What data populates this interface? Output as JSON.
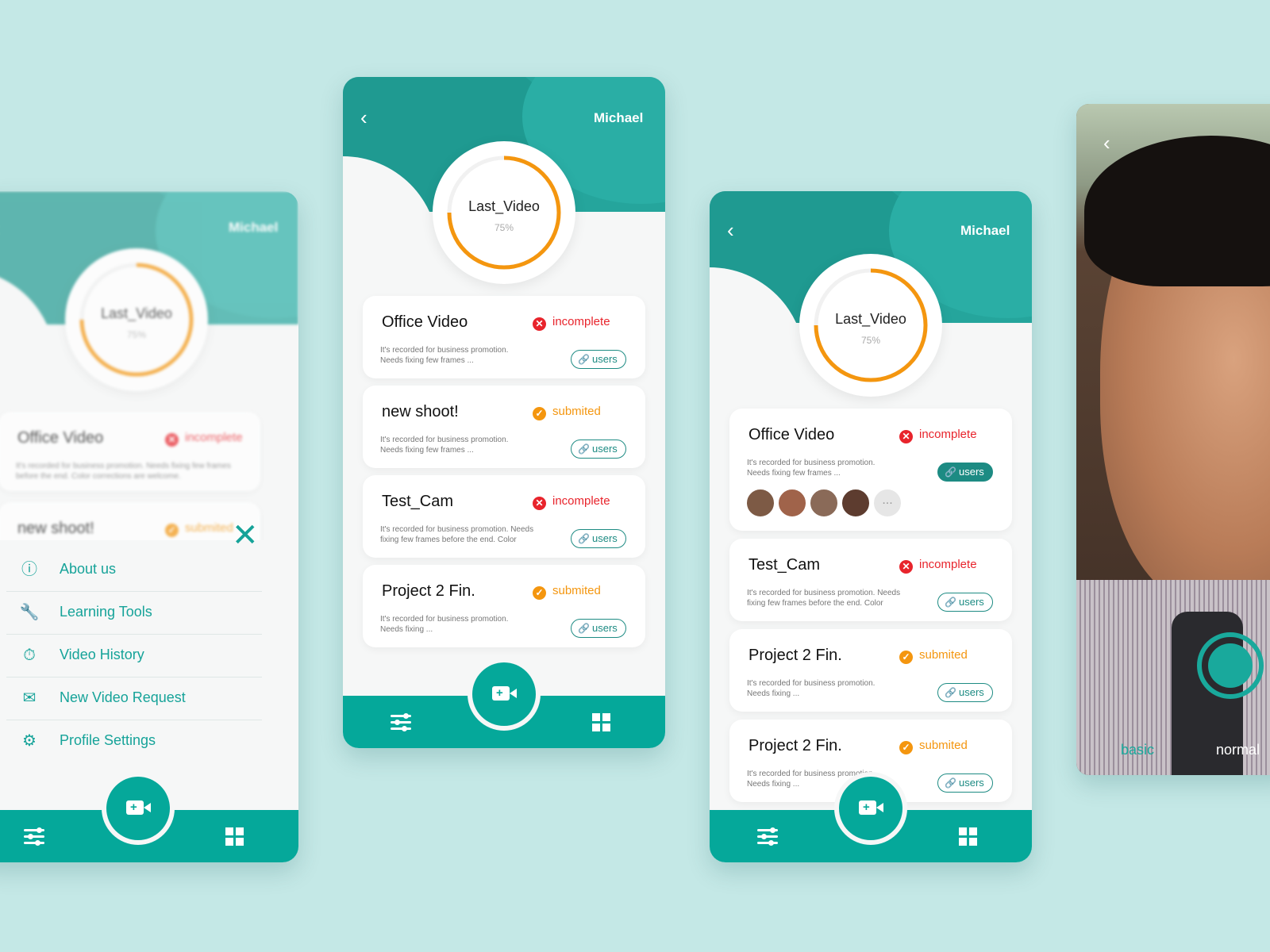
{
  "colors": {
    "teal": "#05a89a",
    "orange": "#f4960f",
    "red": "#e8242c",
    "background": "#c4e8e6"
  },
  "icons": {
    "back": "chevron-left-icon",
    "status_incomplete": "x-circle-icon",
    "status_submitted": "check-circle-icon",
    "users": "link-icon",
    "record": "video-camera-plus-icon",
    "filters": "sliders-icon",
    "apps": "grid-icon",
    "close": "close-icon"
  },
  "user_name": "Michael",
  "last_video": {
    "title": "Last_Video",
    "percent": "75%",
    "progress": 0.75
  },
  "users_label": "users",
  "screen1": {
    "cards": [
      {
        "title": "Office Video",
        "status": "incomplete",
        "desc": "It's recorded for business promotion. Needs fixing few frames before the end. Color corrections are welcome."
      },
      {
        "title": "new shoot!",
        "status": "submited"
      }
    ],
    "menu": [
      {
        "label": "About us",
        "icon": "info-icon"
      },
      {
        "label": "Learning Tools",
        "icon": "wrench-icon"
      },
      {
        "label": "Video History",
        "icon": "stopwatch-icon"
      },
      {
        "label": "New Video Request",
        "icon": "mail-icon"
      },
      {
        "label": "Profile Settings",
        "icon": "gear-icon"
      }
    ]
  },
  "screen2": {
    "cards": [
      {
        "title": "Office Video",
        "status": "incomplete",
        "desc1": "It's recorded for business promotion.",
        "desc2": "Needs fixing few frames ..."
      },
      {
        "title": "new shoot!",
        "status": "submited",
        "desc1": "It's recorded for business promotion.",
        "desc2": "Needs fixing few frames ..."
      },
      {
        "title": "Test_Cam",
        "status": "incomplete",
        "desc1": "It's recorded for business promotion. Needs",
        "desc2": "fixing few frames before the end. Color"
      },
      {
        "title": "Project 2 Fin.",
        "status": "submited",
        "desc1": "It's recorded for business promotion.",
        "desc2": "Needs fixing ..."
      }
    ]
  },
  "screen3": {
    "cards": [
      {
        "title": "Office Video",
        "status": "incomplete",
        "desc1": "It's recorded for business promotion.",
        "desc2": "Needs fixing few frames ..."
      },
      {
        "title": "Test_Cam",
        "status": "incomplete",
        "desc1": "It's recorded for business promotion. Needs",
        "desc2": "fixing few frames before the end. Color"
      },
      {
        "title": "Project 2 Fin.",
        "status": "submited",
        "desc1": "It's recorded for business promotion.",
        "desc2": "Needs fixing ..."
      },
      {
        "title": "Project 2 Fin.",
        "status": "submited",
        "desc1": "It's recorded for business promotion.",
        "desc2": "Needs fixing ..."
      }
    ],
    "more_avatars": "..."
  },
  "screen4": {
    "mode_left": "basic",
    "mode_right": "normal"
  }
}
